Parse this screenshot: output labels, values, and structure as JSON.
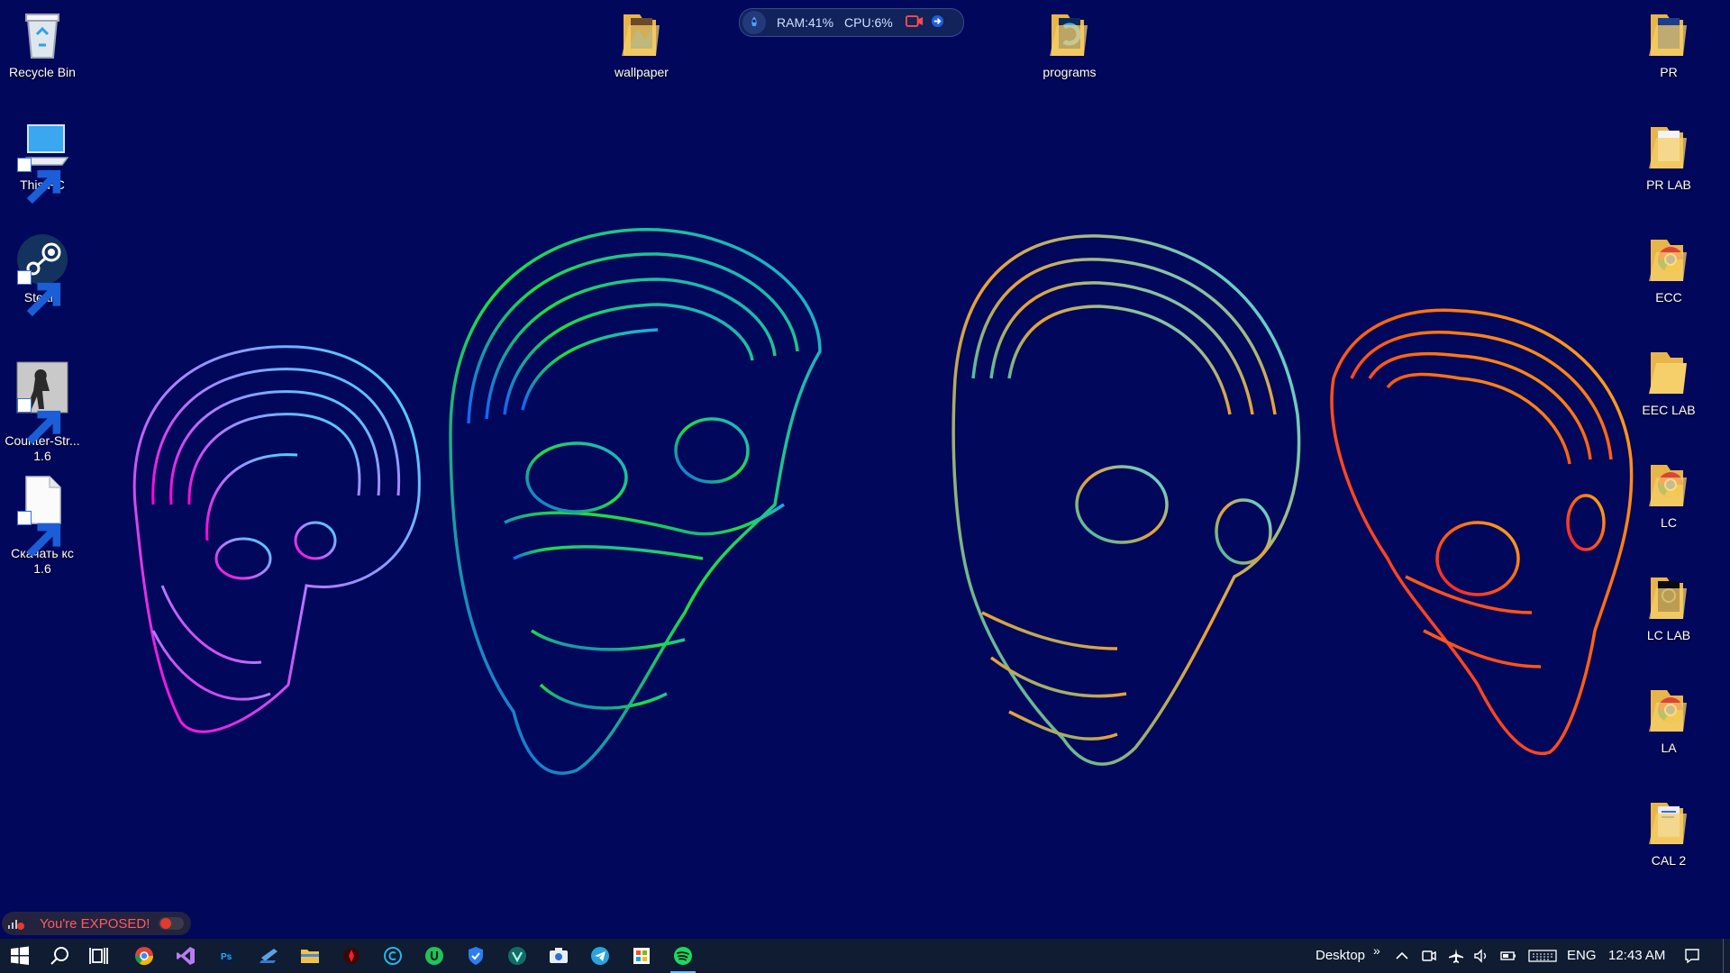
{
  "desktop": {
    "left_icons": [
      {
        "label": "Recycle Bin",
        "icon": "recycle-bin-icon"
      },
      {
        "label": "This PC",
        "icon": "this-pc-icon"
      },
      {
        "label": "Steam",
        "icon": "steam-icon"
      },
      {
        "label": "Counter-Str...\n1.6",
        "icon": "counter-strike-icon"
      },
      {
        "label": "Скачать кс\n1.6",
        "icon": "document-icon"
      }
    ],
    "top_icons": [
      {
        "label": "wallpaper",
        "icon": "folder-icon"
      },
      {
        "label": "programs",
        "icon": "folder-icon"
      }
    ],
    "right_icons": [
      {
        "label": "PR",
        "icon": "folder-icon"
      },
      {
        "label": "PR LAB",
        "icon": "folder-icon"
      },
      {
        "label": "ECC",
        "icon": "chrome-folder-icon"
      },
      {
        "label": "EEC LAB",
        "icon": "folder-icon"
      },
      {
        "label": "LC",
        "icon": "chrome-folder-icon"
      },
      {
        "label": "LC LAB",
        "icon": "folder-icon"
      },
      {
        "label": "LA",
        "icon": "chrome-folder-icon"
      },
      {
        "label": "CAL 2",
        "icon": "folder-icon"
      }
    ]
  },
  "perf_widget": {
    "ram": "RAM:41%",
    "cpu": "CPU:6%"
  },
  "exposed_badge": {
    "text": "You're EXPOSED!"
  },
  "taskbar": {
    "pinned": [
      "start-icon",
      "search-icon",
      "task-view-icon",
      "chrome-icon",
      "visual-studio-icon",
      "photoshop-icon",
      "vscode-icon",
      "file-explorer-icon",
      "app-red-icon",
      "app-c-icon",
      "app-u-icon",
      "shield-icon",
      "vpn-icon",
      "camera-icon",
      "telegram-icon",
      "store-icon",
      "spotify-icon"
    ],
    "desktop_label": "Desktop",
    "chevron": "»",
    "language": "ENG",
    "time": "12:43 AM"
  },
  "colors": {
    "background": "#01075a",
    "taskbar": "#0f1c32",
    "exposed_text": "#ff5b5b",
    "accent": "#76b9ed"
  }
}
